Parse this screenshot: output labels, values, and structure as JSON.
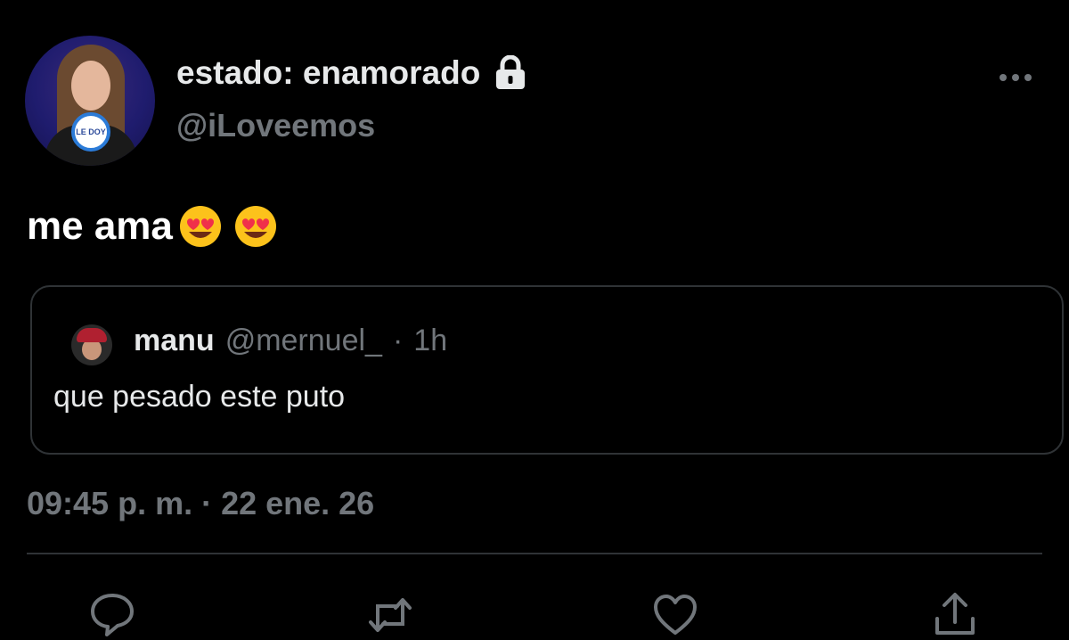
{
  "author": {
    "display_name": "estado: enamorado",
    "handle": "@iLoveemos",
    "avatar_badge": "LE DOY",
    "locked": true
  },
  "tweet": {
    "text": "me ama",
    "emojis": [
      "smiling-face-with-heart-eyes",
      "smiling-face-with-heart-eyes"
    ]
  },
  "quoted_tweet": {
    "name": "manu",
    "handle": "@mernuel_",
    "separator": "·",
    "time": "1h",
    "text": "que pesado este puto"
  },
  "timestamp": "09:45 p. m. · 22 ene. 26",
  "actions": [
    "reply-icon",
    "retweet-icon",
    "like-icon",
    "share-icon"
  ],
  "colors": {
    "background": "#000000",
    "primary_text": "#e7e9ea",
    "secondary_text": "#71767b",
    "border": "#2f3336"
  }
}
